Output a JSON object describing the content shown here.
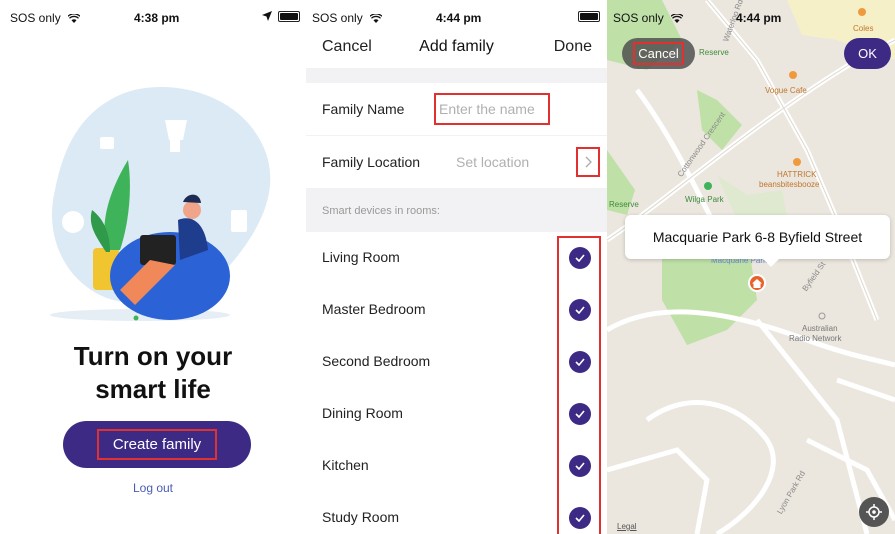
{
  "screen1": {
    "status": {
      "carrier": "SOS only",
      "time": "4:38 pm"
    },
    "headline_line1": "Turn on your",
    "headline_line2": "smart life",
    "create_button": "Create family",
    "logout": "Log out"
  },
  "screen2": {
    "status": {
      "carrier": "SOS only",
      "time": "4:44 pm"
    },
    "nav": {
      "cancel": "Cancel",
      "title": "Add family",
      "done": "Done"
    },
    "family_name_label": "Family Name",
    "family_name_placeholder": "Enter the name",
    "family_location_label": "Family Location",
    "family_location_value": "Set location",
    "section_header": "Smart devices in rooms:",
    "rooms": [
      {
        "name": "Living Room",
        "checked": true
      },
      {
        "name": "Master Bedroom",
        "checked": true
      },
      {
        "name": "Second Bedroom",
        "checked": true
      },
      {
        "name": "Dining Room",
        "checked": true
      },
      {
        "name": "Kitchen",
        "checked": true
      },
      {
        "name": "Study Room",
        "checked": true
      }
    ]
  },
  "screen3": {
    "status": {
      "carrier": "SOS only",
      "time": "4:44 pm"
    },
    "cancel": "Cancel",
    "ok": "OK",
    "callout": "Macquarie Park 6-8 Byfield Street",
    "labels": {
      "coles": "Coles",
      "reserve_top": "Reserve",
      "vogue": "Vogue Cafe",
      "hattrick1": "HATTRICK",
      "hattrick2": "beansbitesbooze",
      "wilga": "Wilga Park",
      "reserve_left": "Reserve",
      "macq_park": "Macquarie Park",
      "australian1": "Australian",
      "australian2": "Radio Network",
      "cottonwood": "Cottonwood Crescent",
      "byfield": "Byfield St",
      "lyon": "Lyon Park Rd",
      "waterloo": "Waterloo Rd",
      "legal": "Legal"
    }
  },
  "colors": {
    "accent": "#3c2a84",
    "highlight": "#e03030",
    "map_bg": "#ebe7df",
    "park": "#bfe0a7",
    "pin": "#e8622c"
  }
}
